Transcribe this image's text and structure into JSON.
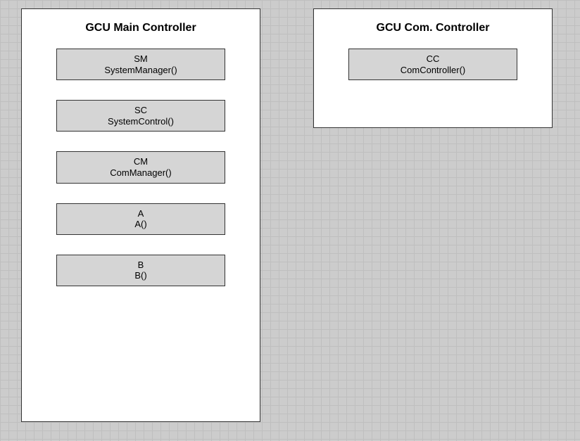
{
  "containers": {
    "main": {
      "title": "GCU Main Controller",
      "components": [
        {
          "name": "SM",
          "func": "SystemManager()"
        },
        {
          "name": "SC",
          "func": "SystemControl()"
        },
        {
          "name": "CM",
          "func": "ComManager()"
        },
        {
          "name": "A",
          "func": "A()"
        },
        {
          "name": "B",
          "func": "B()"
        }
      ]
    },
    "com": {
      "title": "GCU Com. Controller",
      "components": [
        {
          "name": "CC",
          "func": "ComController()"
        }
      ]
    }
  }
}
